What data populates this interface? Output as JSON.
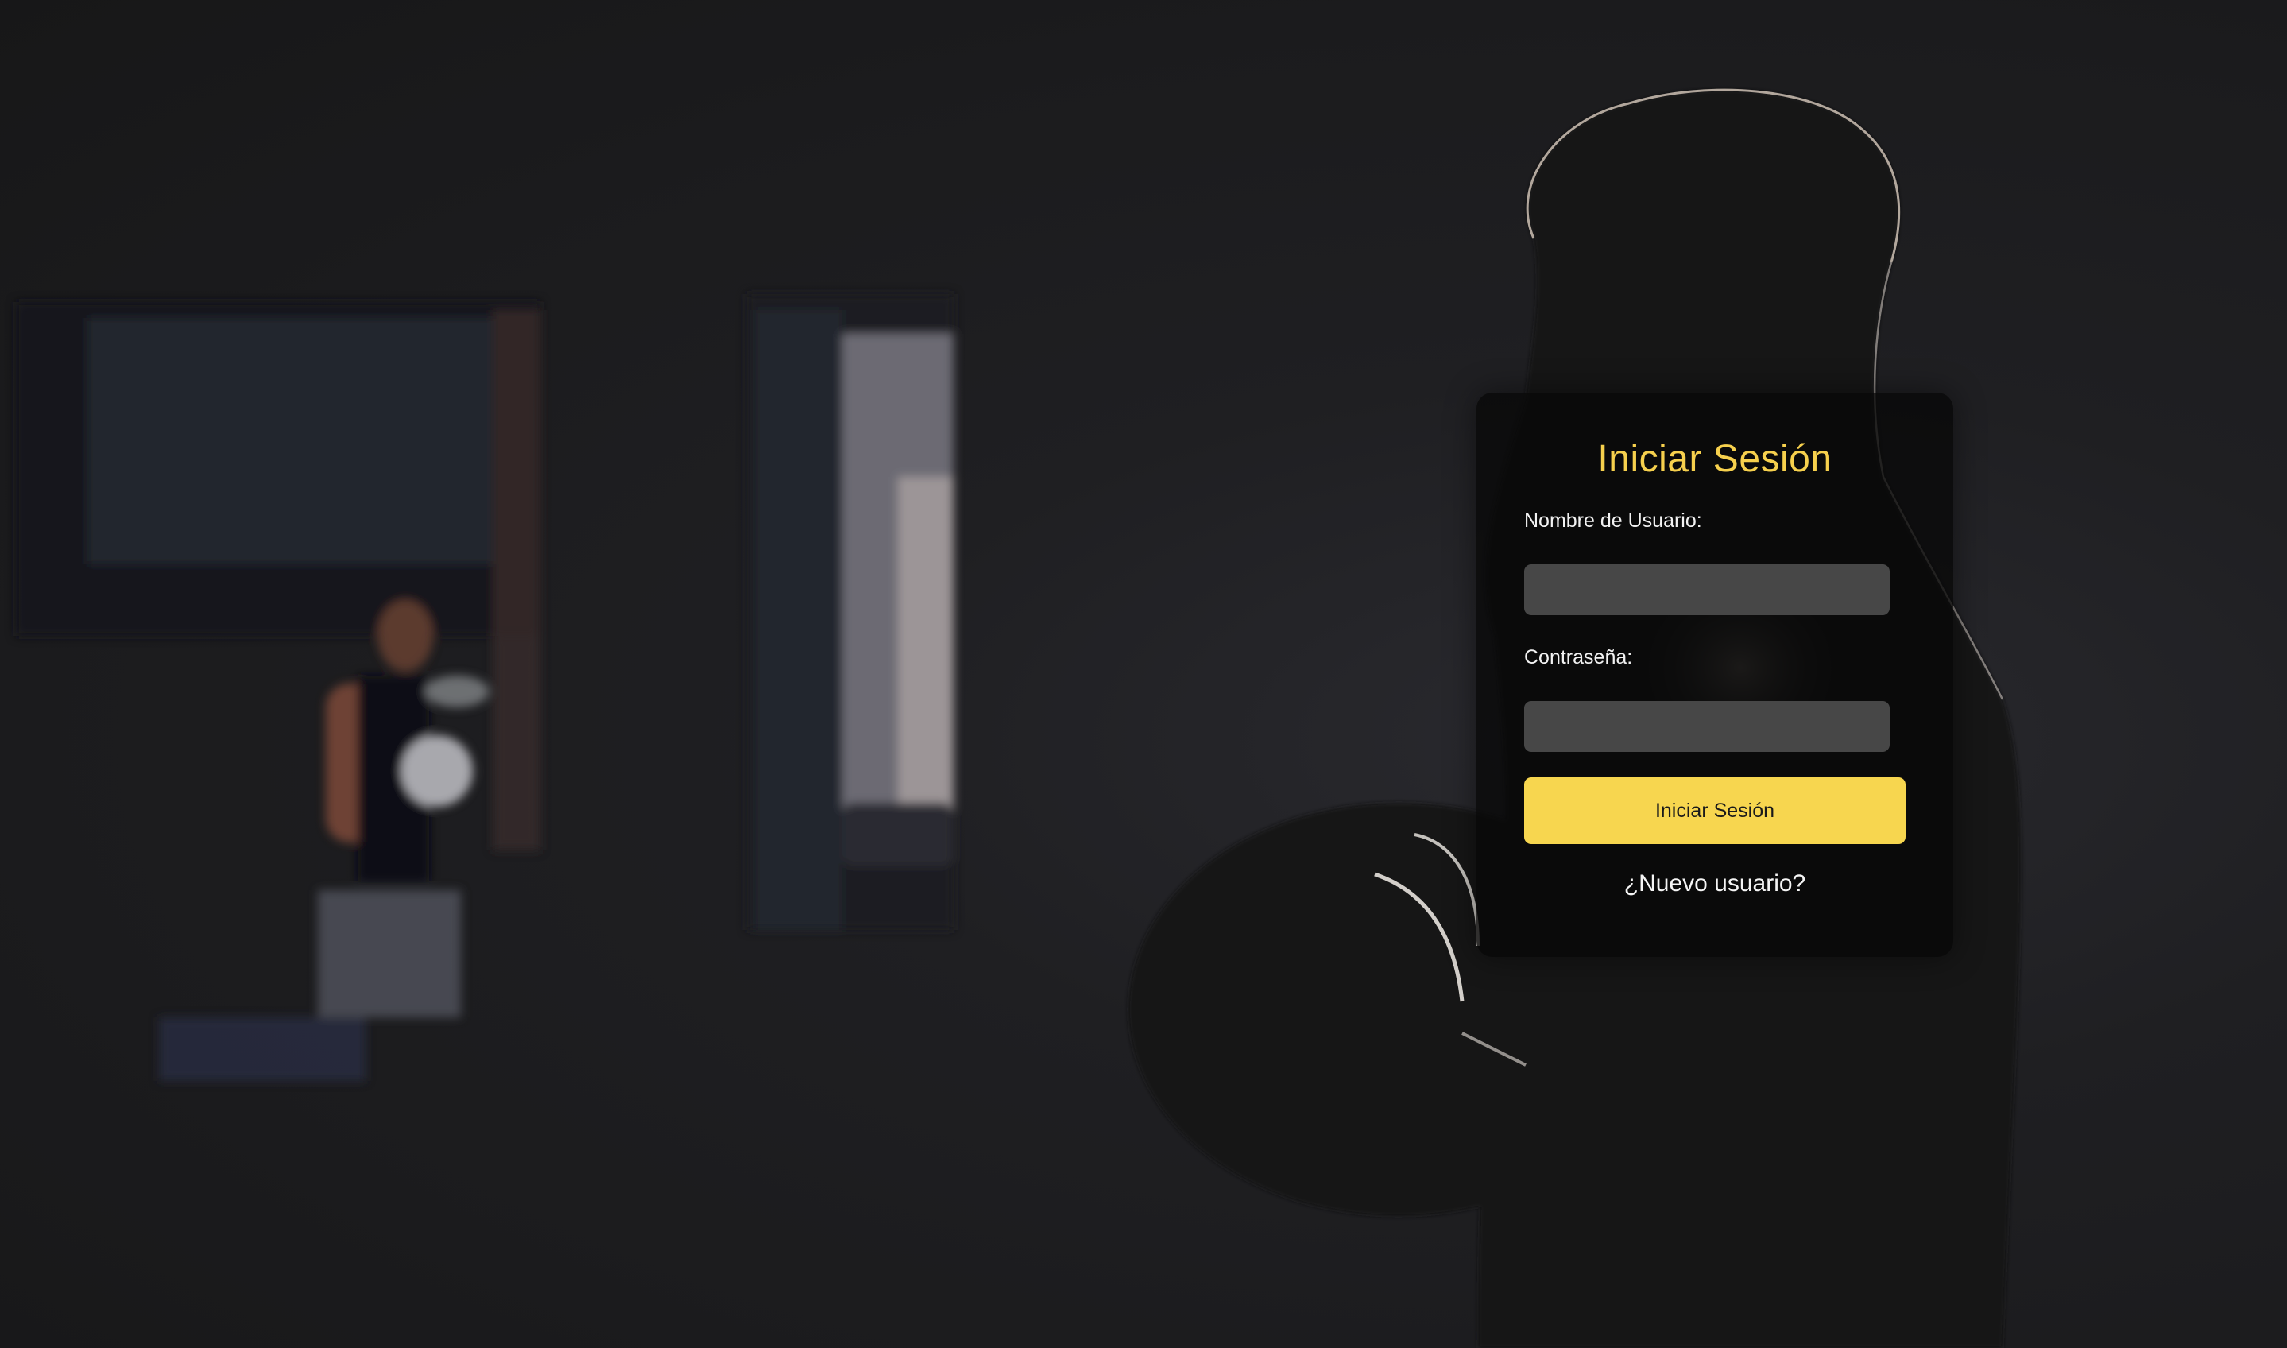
{
  "login": {
    "title": "Iniciar Sesión",
    "username_label": "Nombre de Usuario:",
    "username_value": "",
    "password_label": "Contraseña:",
    "password_value": "",
    "submit_label": "Iniciar Sesión",
    "register_link": "¿Nuevo usuario?"
  },
  "colors": {
    "accent": "#f7d64f",
    "card_background": "#0a0a0a",
    "input_background": "#474747",
    "page_background": "#1d1d1f"
  }
}
